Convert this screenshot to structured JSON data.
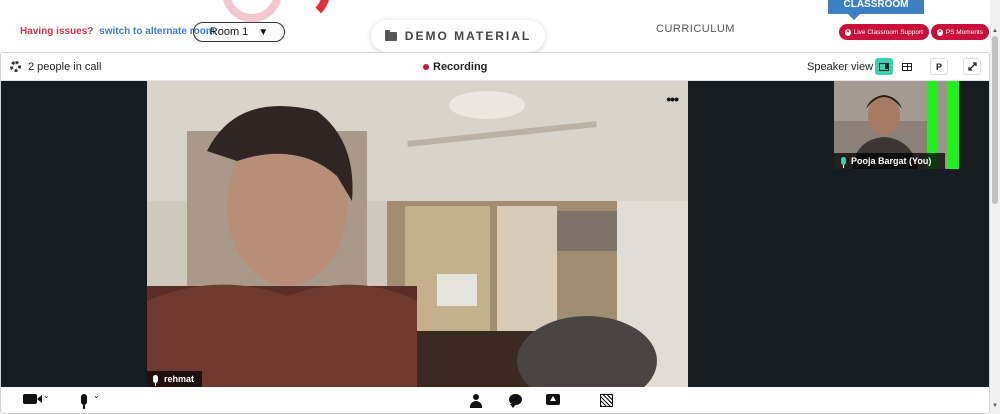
{
  "topbar": {
    "issues_text": "Having issues?",
    "alternate_link": "switch to alternate room",
    "room_value": "Room 1",
    "demo_label": "DEMO MATERIAL",
    "curriculum_label": "CURRICULUM",
    "classroom_tab": "CLASSROOM",
    "support_label": "Live Classroom Support",
    "moments_label": "PS Moments"
  },
  "call": {
    "people_count": "2 people in call",
    "recording_label": "Recording",
    "view_label": "Speaker view",
    "p_button": "P",
    "main_participant": "rehmat",
    "self_participant": "Pooja Bargat (You)"
  },
  "icons": [
    "gear-icon",
    "folder-icon",
    "camera-icon",
    "microphone-icon",
    "participants-icon",
    "chat-icon",
    "screen-share-icon",
    "whiteboard-icon",
    "fullscreen-icon"
  ],
  "colors": {
    "accent": "#3bd1b0",
    "alert": "#c8103a",
    "link": "#3a7bd5",
    "classroom_tab": "#3b7fc4",
    "stage": "#151c22"
  }
}
